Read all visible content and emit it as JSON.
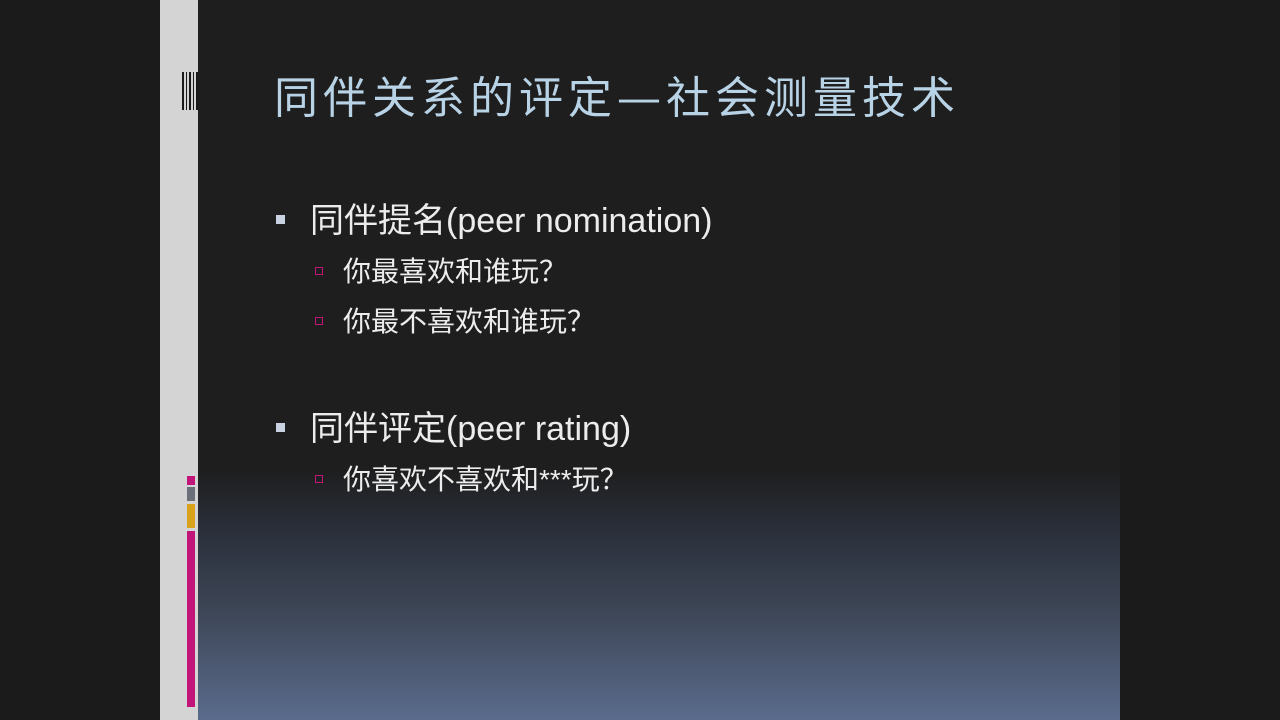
{
  "slide": {
    "title": "同伴关系的评定—社会测量技术",
    "bullets": [
      {
        "text": "同伴提名(peer nomination)",
        "sub": [
          "你最喜欢和谁玩？",
          "你最不喜欢和谁玩？"
        ]
      },
      {
        "text": "同伴评定(peer rating)",
        "sub": [
          "你喜欢不喜欢和***玩？"
        ]
      }
    ]
  },
  "colors": {
    "title": "#b9d3e6",
    "text": "#ececec",
    "accent_magenta": "#c1157a",
    "accent_gold": "#d9a21b",
    "accent_gray": "#6b6f7a",
    "strip": "#d4d4d4",
    "background_top": "#1e1e1e",
    "background_bottom": "#5a6b8c"
  }
}
